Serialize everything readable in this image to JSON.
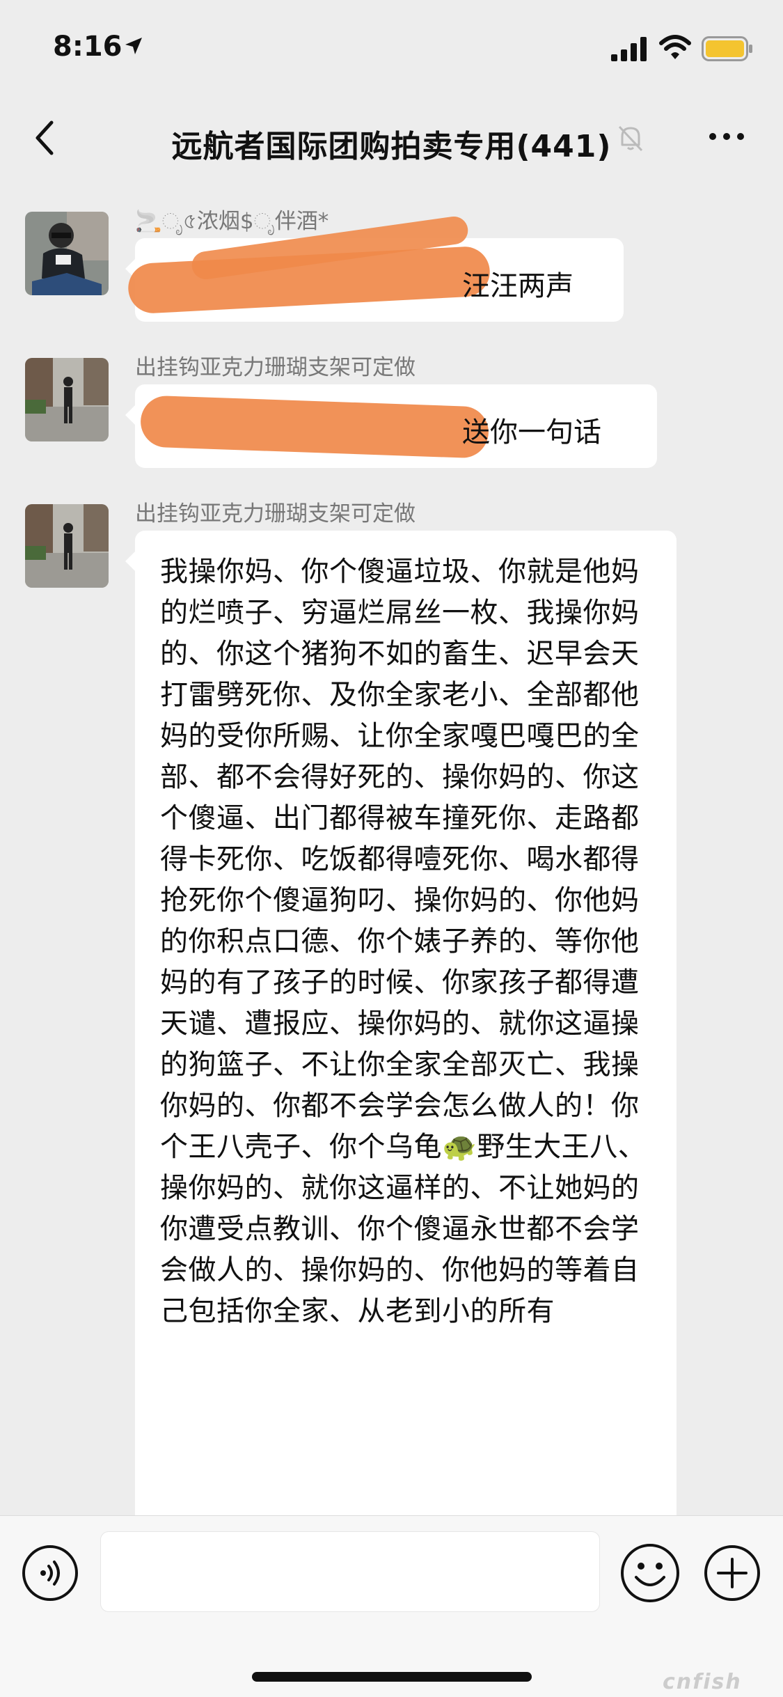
{
  "status_bar": {
    "time": "8:16"
  },
  "header": {
    "title": "远航者国际团购拍卖专用(441)"
  },
  "messages": [
    {
      "sender": "🚬ೃ৫浓烟$ೃ伴酒*",
      "text": "汪汪两声"
    },
    {
      "sender": "出挂钩亚克力珊瑚支架可定做",
      "text": "送你一句话"
    },
    {
      "sender": "出挂钩亚克力珊瑚支架可定做",
      "text": "我操你妈、你个傻逼垃圾、你就是他妈的烂喷子、穷逼烂屌丝一枚、我操你妈的、你这个猪狗不如的畜生、迟早会天打雷劈死你、及你全家老小、全部都他妈的受你所赐、让你全家嘎巴嘎巴的全部、都不会得好死的、操你妈的、你这个傻逼、出门都得被车撞死你、走路都得卡死你、吃饭都得噎死你、喝水都得抢死你个傻逼狗叼、操你妈的、你他妈的你积点口德、你个婊子养的、等你他妈的有了孩子的时候、你家孩子都得遭天谴、遭报应、操你妈的、就你这逼操的狗篮子、不让你全家全部灭亡、我操你妈的、你都不会学会怎么做人的！你个王八壳子、你个乌龟🐢野生大王八、操你妈的、就你这逼样的、不让她妈的你遭受点教训、你个傻逼永世都不会学会做人的、操你妈的、你他妈的等着自己包括你全家、从老到小的所有"
    }
  ],
  "watermark": "cnfish"
}
